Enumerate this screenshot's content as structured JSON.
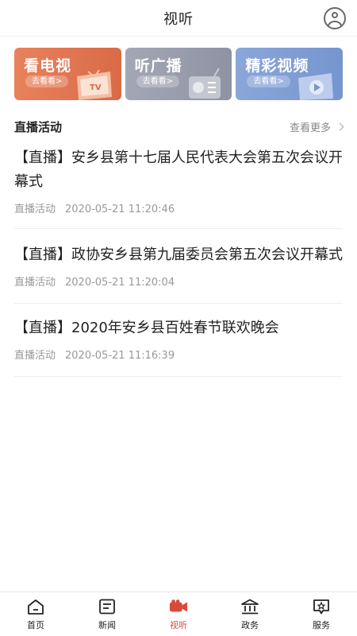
{
  "header": {
    "title": "视听"
  },
  "cards": [
    {
      "title": "看电视",
      "button": "去看看>"
    },
    {
      "title": "听广播",
      "button": "去看看>"
    },
    {
      "title": "精彩视频",
      "button": "去看看>"
    }
  ],
  "section": {
    "title": "直播活动",
    "more": "查看更多"
  },
  "items": [
    {
      "title": "【直播】安乡县第十七届人民代表大会第五次会议开幕式",
      "category": "直播活动",
      "time": "2020-05-21 11:20:46"
    },
    {
      "title": "【直播】政协安乡县第九届委员会第五次会议开幕式",
      "category": "直播活动",
      "time": "2020-05-21 11:20:04"
    },
    {
      "title": "【直播】2020年安乡县百姓春节联欢晚会",
      "category": "直播活动",
      "time": "2020-05-21 11:16:39"
    }
  ],
  "tabbar": [
    {
      "label": "首页",
      "icon": "home-icon",
      "active": false
    },
    {
      "label": "新闻",
      "icon": "news-icon",
      "active": false
    },
    {
      "label": "视听",
      "icon": "video-camera-icon",
      "active": true
    },
    {
      "label": "政务",
      "icon": "government-icon",
      "active": false
    },
    {
      "label": "服务",
      "icon": "service-icon",
      "active": false
    }
  ],
  "colors": {
    "accent": "#d94a3a",
    "tv_card": "#e07a55",
    "radio_card": "#9ba0ae",
    "video_card": "#809dd3"
  }
}
